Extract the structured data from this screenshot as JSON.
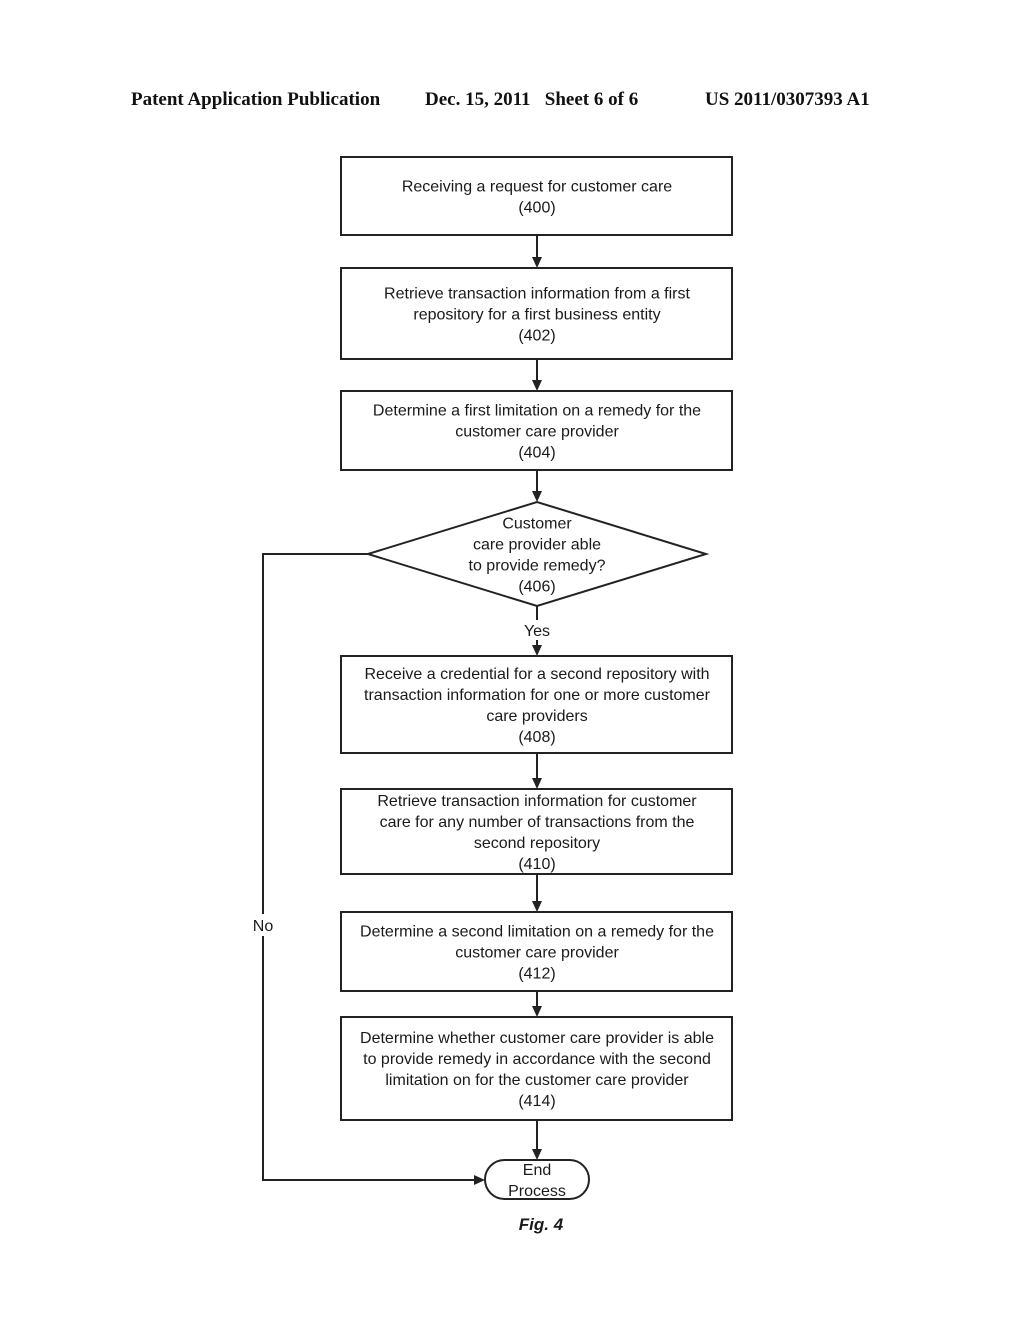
{
  "header": {
    "publication_type": "Patent Application Publication",
    "date_sheet": "Dec. 15, 2011   Sheet 6 of 6",
    "patent_number": "US 2011/0307393 A1"
  },
  "diagram": {
    "steps": [
      {
        "id": "400",
        "lines": [
          "Receiving a request for customer care",
          "(400)"
        ]
      },
      {
        "id": "402",
        "lines": [
          "Retrieve transaction information from a first",
          "repository for a first business entity",
          "(402)"
        ]
      },
      {
        "id": "404",
        "lines": [
          "Determine a first limitation on a remedy for the",
          "customer care provider",
          "(404)"
        ]
      },
      {
        "id": "408",
        "lines": [
          "Receive a credential for a second repository with",
          "transaction information for one or more customer",
          "care providers",
          "(408)"
        ]
      },
      {
        "id": "410",
        "lines": [
          "Retrieve transaction information for customer",
          "care for any number of transactions from the",
          "second repository",
          "(410)"
        ]
      },
      {
        "id": "412",
        "lines": [
          "Determine a second limitation on a remedy for the",
          "customer care provider",
          "(412)"
        ]
      },
      {
        "id": "414",
        "lines": [
          "Determine whether customer care provider is able",
          "to provide remedy in accordance with the second",
          "limitation on for the customer care provider",
          "(414)"
        ]
      }
    ],
    "decision": {
      "id": "406",
      "lines": [
        "Customer",
        "care provider able",
        "to provide remedy?",
        "(406)"
      ]
    },
    "yes_label": "Yes",
    "no_label": "No",
    "end": {
      "lines": [
        "End",
        "Process"
      ]
    },
    "figure_caption": "Fig. 4"
  }
}
